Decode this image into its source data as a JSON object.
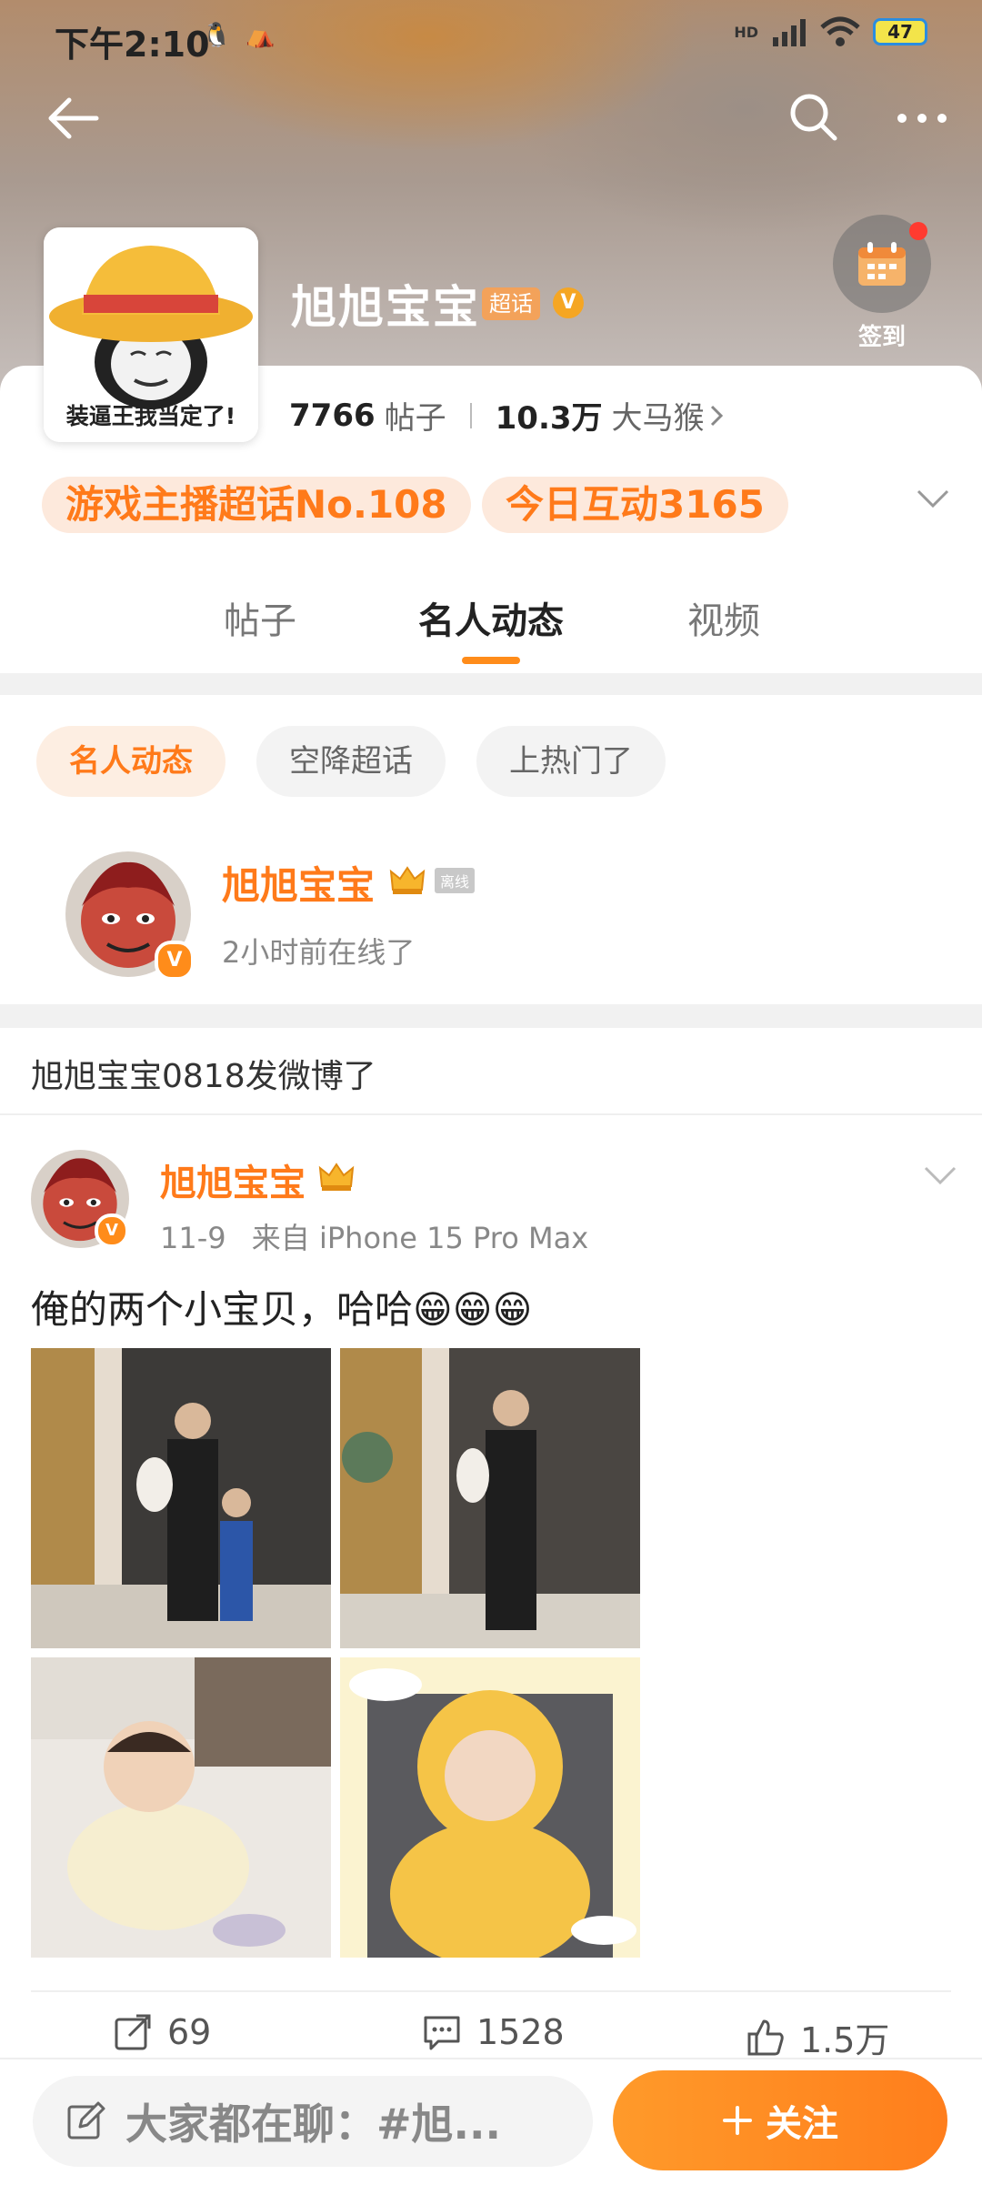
{
  "status_bar": {
    "time": "下午2:10",
    "network": "HD",
    "battery": "47"
  },
  "header": {
    "forum_name": "旭旭宝宝",
    "badge": "超话",
    "checkin_label": "签到",
    "avatar_caption": "装逼王我当定了!"
  },
  "stats": {
    "posts_count": "7766",
    "posts_label": "帖子",
    "fans_count": "10.3万",
    "fans_label": "大马猴"
  },
  "ranks": {
    "rank_label": "游戏主播超话No.108",
    "interaction_label": "今日互动3165"
  },
  "tabs": [
    "帖子",
    "名人动态",
    "视频"
  ],
  "filters": [
    "名人动态",
    "空降超话",
    "上热门了"
  ],
  "celebrity": {
    "name": "旭旭宝宝",
    "offline_tag": "离线",
    "status": "2小时前在线了"
  },
  "notice": "旭旭宝宝0818发微博了",
  "post": {
    "author": "旭旭宝宝",
    "date": "11-9",
    "source": "来自 iPhone 15 Pro Max",
    "text": "俺的两个小宝贝，哈哈😁😁😁",
    "reposts": "69",
    "comments": "1528",
    "likes": "1.5万"
  },
  "bottom_bar": {
    "chat_placeholder": "大家都在聊：#旭...",
    "follow_label": "关注"
  },
  "colors": {
    "accent": "#ff7a1a",
    "accent_light": "#fdeee2",
    "badge_red": "#ff3b30"
  }
}
